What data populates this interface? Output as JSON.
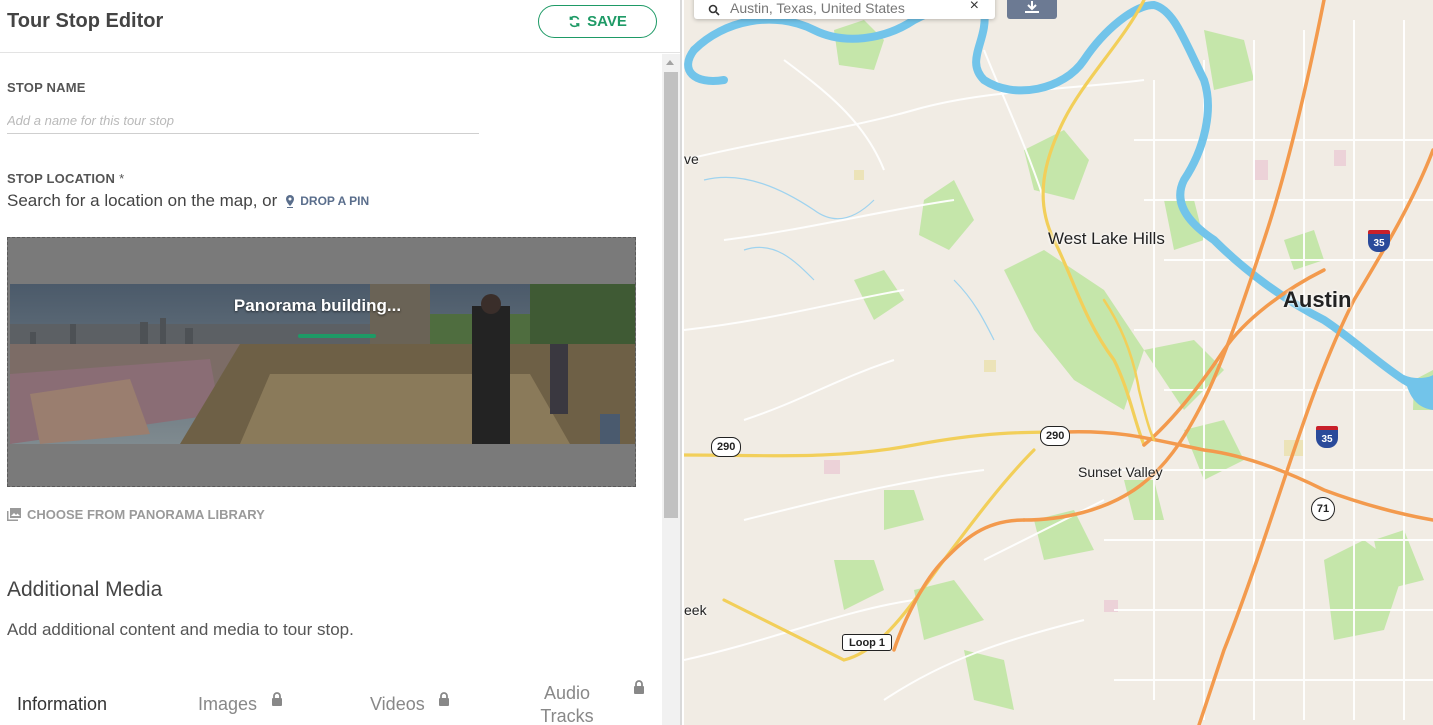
{
  "editor": {
    "title": "Tour Stop Editor",
    "save_label": "SAVE",
    "stop_name": {
      "label": "STOP NAME",
      "placeholder": "Add a name for this tour stop",
      "value": ""
    },
    "stop_location": {
      "label": "STOP LOCATION",
      "required_mark": "*",
      "search_text": "Search for a location on the map, or",
      "drop_pin_label": "DROP A PIN"
    },
    "panorama": {
      "status": "Panorama building...",
      "progress": 0.35
    },
    "choose_library_label": "CHOOSE FROM PANORAMA LIBRARY",
    "additional_media": {
      "title": "Additional Media",
      "description": "Add additional content and media to tour stop."
    },
    "tabs": [
      {
        "label": "Information",
        "active": true,
        "locked": false
      },
      {
        "label": "Images",
        "active": false,
        "locked": true
      },
      {
        "label": "Videos",
        "active": false,
        "locked": true
      },
      {
        "label": "Audio Tracks",
        "active": false,
        "locked": true
      }
    ]
  },
  "map": {
    "search_value": "Austin, Texas, United States",
    "labels": {
      "austin": "Austin",
      "west_lake_hills": "West Lake Hills",
      "sunset_valley": "Sunset Valley",
      "edge_top": "ve",
      "edge_bottom": "eek"
    },
    "shields": {
      "us290_west": "290",
      "us290_east": "290",
      "i35_north": "35",
      "i35_south": "35",
      "sh71": "71",
      "loop1": "Loop 1"
    },
    "colors": {
      "water": "#6fc3e8",
      "park": "#bfe3a0",
      "highway": "#f39c4c",
      "major_road": "#f5d66b",
      "land": "#f1ece4"
    }
  },
  "colors": {
    "accent": "#1e9a66",
    "pin_link": "#5a6e8c"
  }
}
